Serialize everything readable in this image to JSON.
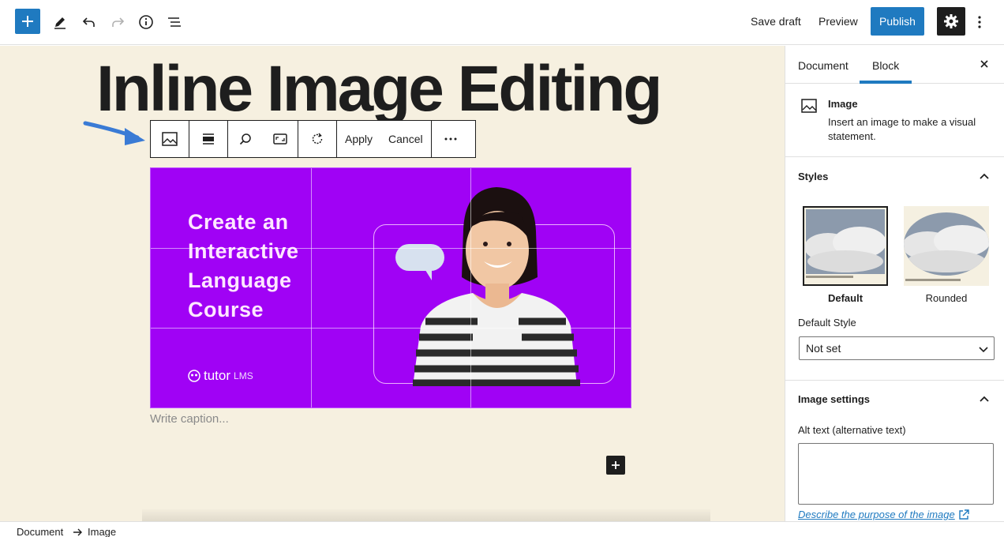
{
  "topbar": {
    "save_draft": "Save draft",
    "preview": "Preview",
    "publish": "Publish",
    "icons": [
      "plus-icon",
      "pencil-icon",
      "undo-icon",
      "redo-icon",
      "info-icon",
      "list-view-icon",
      "gear-icon",
      "more-vertical-icon"
    ]
  },
  "post": {
    "title": "Inline Image Editing",
    "caption_placeholder": "Write caption..."
  },
  "block_toolbar": {
    "apply": "Apply",
    "cancel": "Cancel"
  },
  "image": {
    "headline_lines": [
      "Create an",
      "Interactive",
      "Language",
      "Course"
    ],
    "logo_text": "tutor",
    "logo_suffix": "LMS",
    "background": "#a002f5"
  },
  "sidebar": {
    "tabs": [
      "Document",
      "Block"
    ],
    "active_tab": "Block",
    "block_card": {
      "title": "Image",
      "description": "Insert an image to make a visual statement."
    },
    "styles": {
      "title": "Styles",
      "options": [
        "Default",
        "Rounded"
      ],
      "default_style_label": "Default Style",
      "default_style_value": "Not set"
    },
    "image_settings": {
      "title": "Image settings",
      "alt_label": "Alt text (alternative text)",
      "describe_link": "Describe the purpose of the image"
    }
  },
  "breadcrumb": [
    "Document",
    "Image"
  ],
  "colors": {
    "accent": "#1f7ac0",
    "canvas": "#f6f0e0",
    "dark": "#1e1e1e"
  }
}
